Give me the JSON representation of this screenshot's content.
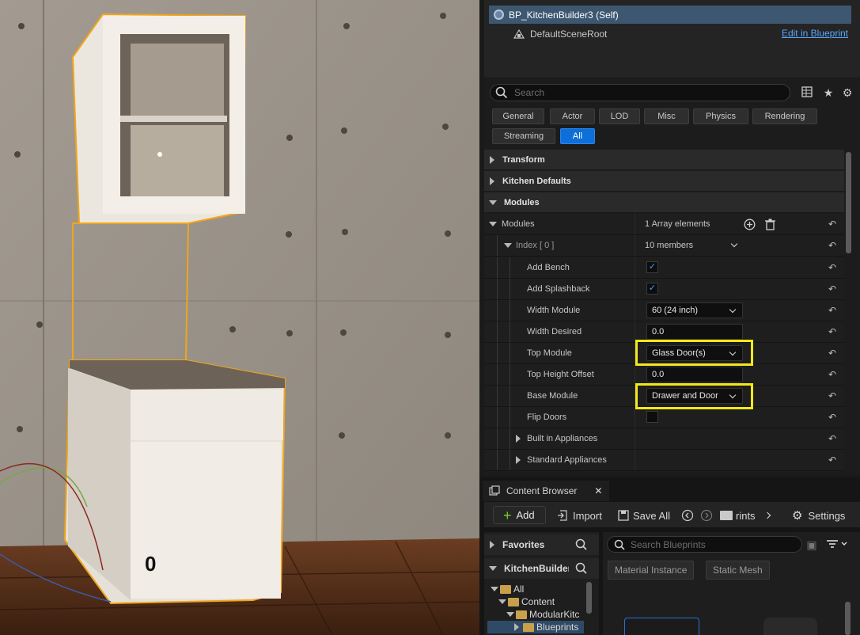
{
  "outliner": {
    "selected_actor": "BP_KitchenBuilder3 (Self)",
    "root_component": "DefaultSceneRoot",
    "edit_link": "Edit in Blueprint"
  },
  "details": {
    "search_placeholder": "Search",
    "filters": [
      "General",
      "Actor",
      "LOD",
      "Misc",
      "Physics",
      "Rendering",
      "Streaming",
      "All"
    ],
    "active_filter": "All",
    "categories": {
      "transform": "Transform",
      "kitchen_defaults": "Kitchen Defaults",
      "modules": "Modules"
    },
    "modules_array": {
      "label": "Modules",
      "value": "1 Array elements"
    },
    "index": {
      "label": "Index [ 0 ]",
      "value": "10 members"
    },
    "props": {
      "add_bench": {
        "label": "Add Bench",
        "checked": true
      },
      "add_splashback": {
        "label": "Add Splashback",
        "checked": true
      },
      "width_module": {
        "label": "Width Module",
        "value": "60 (24 inch)"
      },
      "width_desired": {
        "label": "Width Desired",
        "value": "0.0"
      },
      "top_module": {
        "label": "Top Module",
        "value": "Glass Door(s)"
      },
      "top_height_offset": {
        "label": "Top Height Offset",
        "value": "0.0"
      },
      "base_module": {
        "label": "Base Module",
        "value": "Drawer and Door"
      },
      "flip_doors": {
        "label": "Flip Doors",
        "checked": false
      },
      "built_in_appliances": {
        "label": "Built in Appliances"
      },
      "standard_appliances": {
        "label": "Standard Appliances"
      }
    },
    "checkmark": "✓",
    "highlight_color": "#f2e81a"
  },
  "content_browser": {
    "tab_title": "Content Browser",
    "close": "✕",
    "add": "Add",
    "import": "Import",
    "save_all": "Save All",
    "path_crumb": "rints",
    "settings": "Settings",
    "favorites": "Favorites",
    "kitchen": "KitchenBuilder",
    "tree": [
      "All",
      "Content",
      "ModularKitc",
      "Blueprints"
    ],
    "search_placeholder": "Search Blueprints",
    "chips": [
      "Material Instance",
      "Static Mesh"
    ]
  },
  "viewport": {
    "index_label": "0"
  }
}
